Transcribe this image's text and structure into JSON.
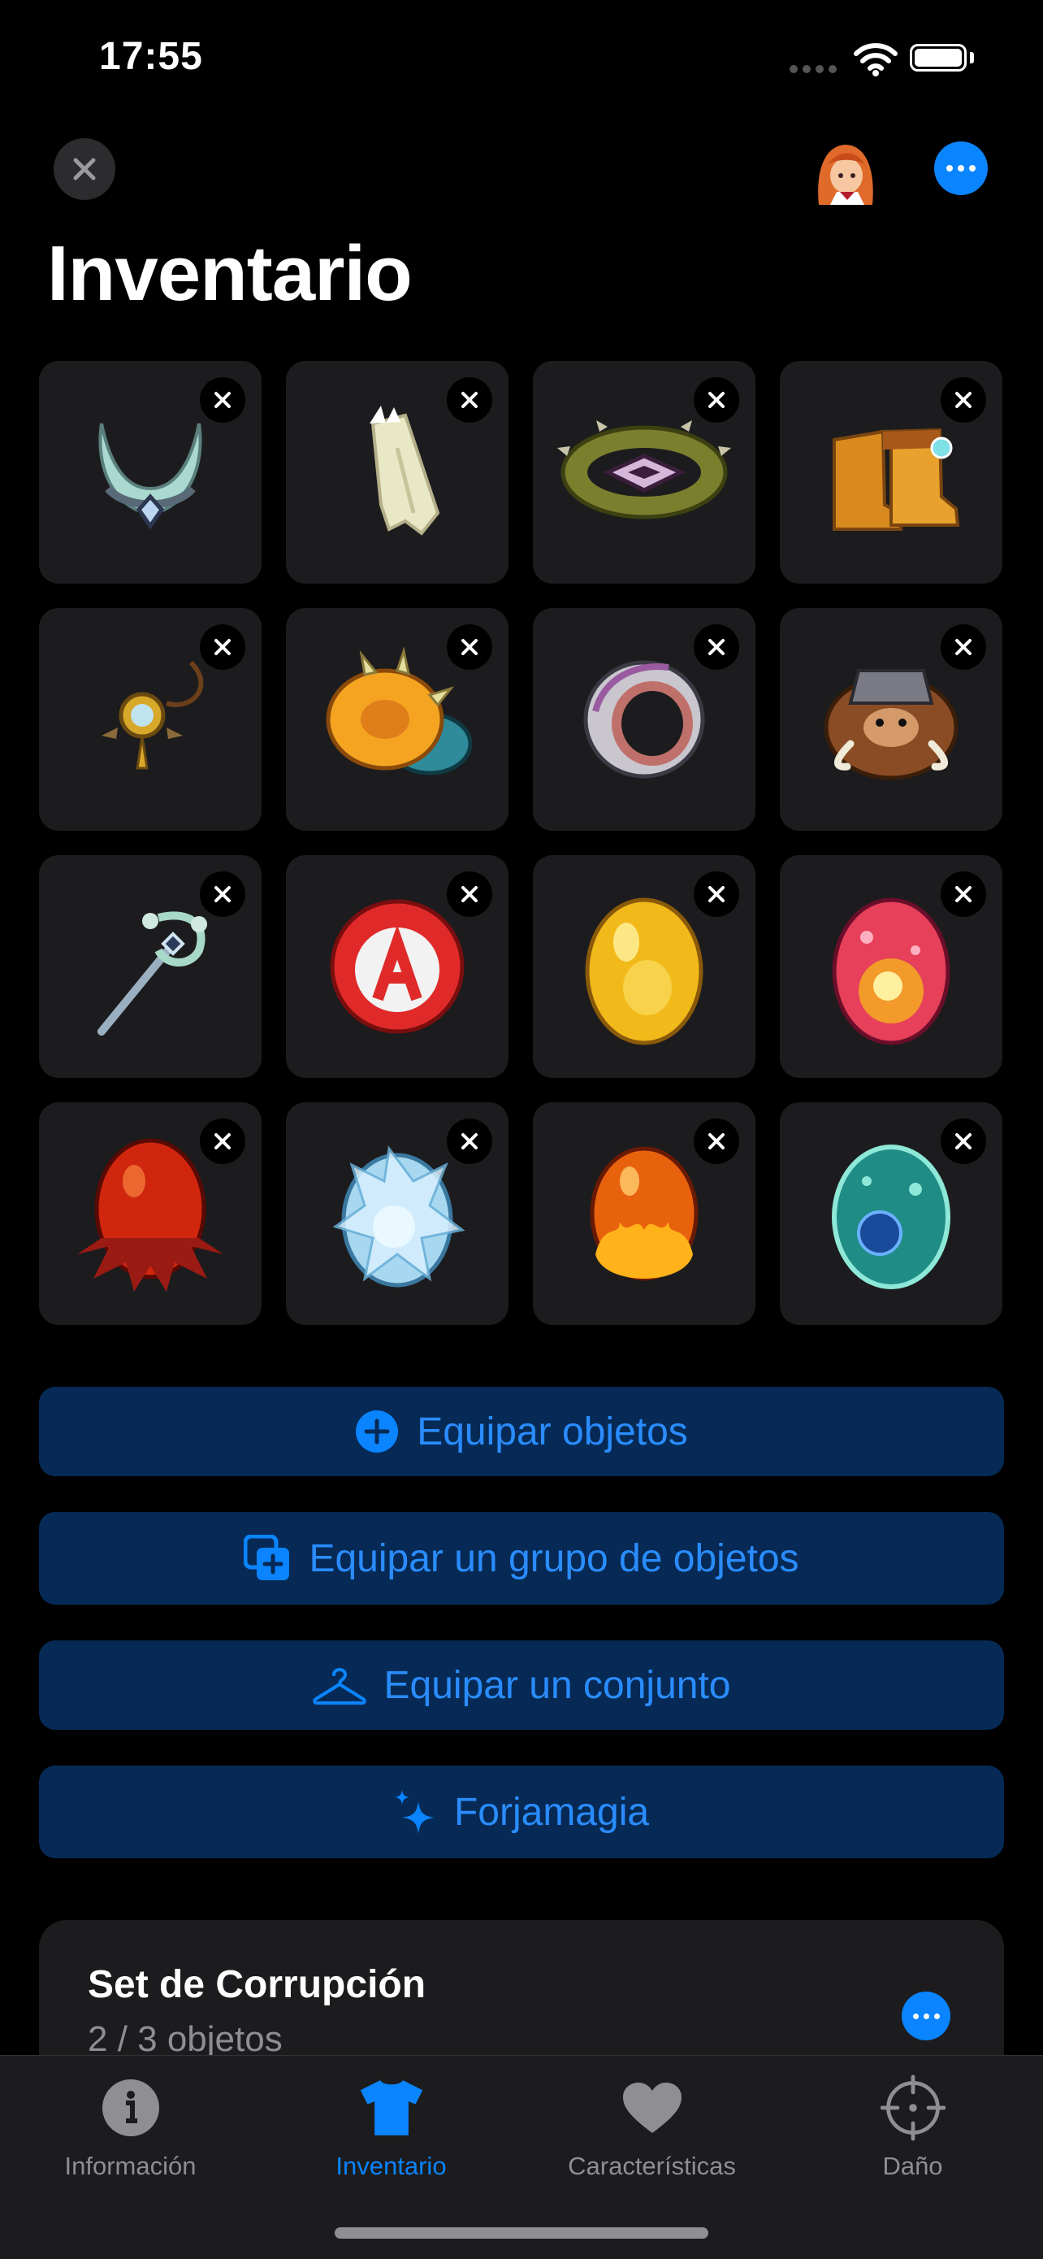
{
  "status_bar": {
    "time": "17:55"
  },
  "header": {
    "title": "Inventario"
  },
  "inventory": {
    "items": [
      {
        "name": "amulet-crescent-icon"
      },
      {
        "name": "cape-spiked-icon"
      },
      {
        "name": "belt-spiked-icon"
      },
      {
        "name": "boots-icon"
      },
      {
        "name": "pendant-gold-icon"
      },
      {
        "name": "shield-ring-icon"
      },
      {
        "name": "ring-silver-icon"
      },
      {
        "name": "mount-mammoth-icon"
      },
      {
        "name": "staff-icon"
      },
      {
        "name": "round-shield-icon"
      },
      {
        "name": "egg-gold-icon"
      },
      {
        "name": "egg-pink-icon"
      },
      {
        "name": "egg-red-icon"
      },
      {
        "name": "egg-ice-icon"
      },
      {
        "name": "egg-fire-icon"
      },
      {
        "name": "egg-teal-icon"
      }
    ]
  },
  "actions": {
    "equip_items": "Equipar objetos",
    "equip_group": "Equipar un grupo de objetos",
    "equip_set": "Equipar un conjunto",
    "forgemagic": "Forjamagia"
  },
  "set_card": {
    "title": "Set de Corrupción",
    "subtitle": "2 / 3 objetos"
  },
  "tabs": [
    {
      "label": "Información"
    },
    {
      "label": "Inventario"
    },
    {
      "label": "Características"
    },
    {
      "label": "Daño"
    }
  ],
  "colors": {
    "accent": "#0a84ff",
    "button_bg": "#062a55",
    "card_bg": "#1c1c1e"
  }
}
